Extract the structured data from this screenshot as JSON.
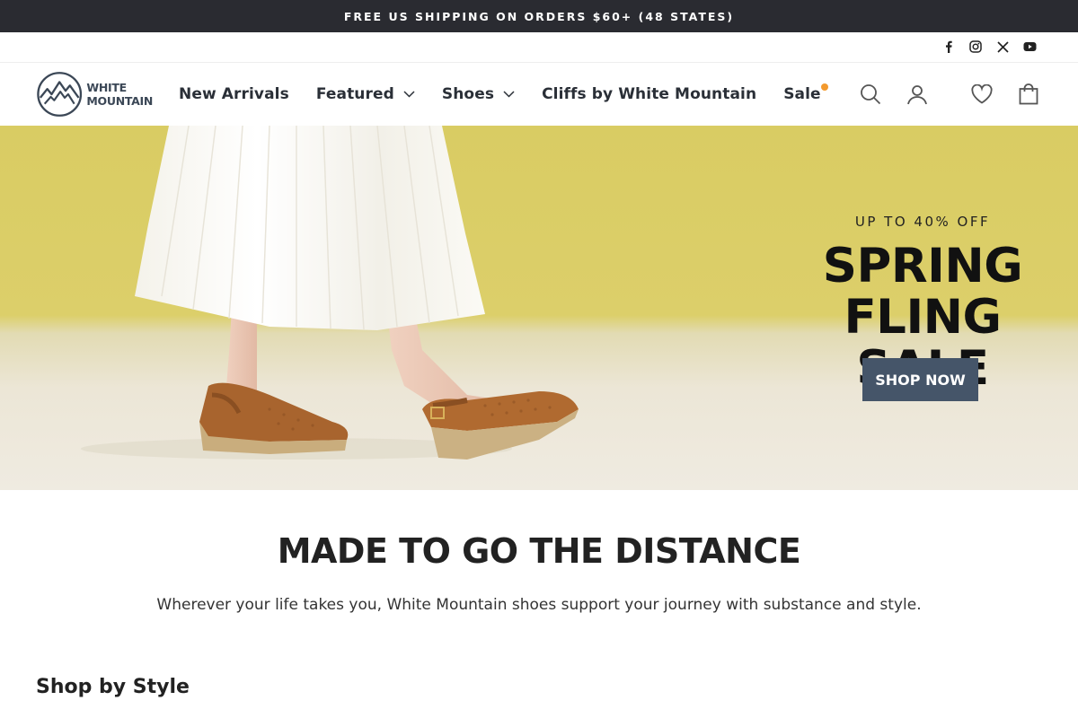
{
  "announcement": "FREE US SHIPPING ON ORDERS $60+ (48 STATES)",
  "social": [
    "facebook-icon",
    "instagram-icon",
    "x-icon",
    "youtube-icon"
  ],
  "brand": {
    "name_line1": "WHITE",
    "name_line2": "MOUNTAIN",
    "colors": {
      "navy": "#3b4756",
      "accent": "#f39a2e",
      "button": "#455569",
      "bar": "#2a2b31"
    }
  },
  "nav": {
    "new_arrivals": "New Arrivals",
    "featured": "Featured",
    "shoes": "Shoes",
    "cliffs": "Cliffs by White Mountain",
    "sale": "Sale"
  },
  "header_icons": [
    "search-icon",
    "account-icon",
    "wishlist-icon",
    "cart-icon"
  ],
  "hero": {
    "eyebrow": "UP TO 40% OFF",
    "title_line1": "SPRING",
    "title_line2": "FLING SALE",
    "cta": "SHOP NOW"
  },
  "intro": {
    "headline": "MADE TO GO THE DISTANCE",
    "body": "Wherever your life takes you, White Mountain shoes support your journey with substance and style."
  },
  "shop_by_style": "Shop by Style"
}
